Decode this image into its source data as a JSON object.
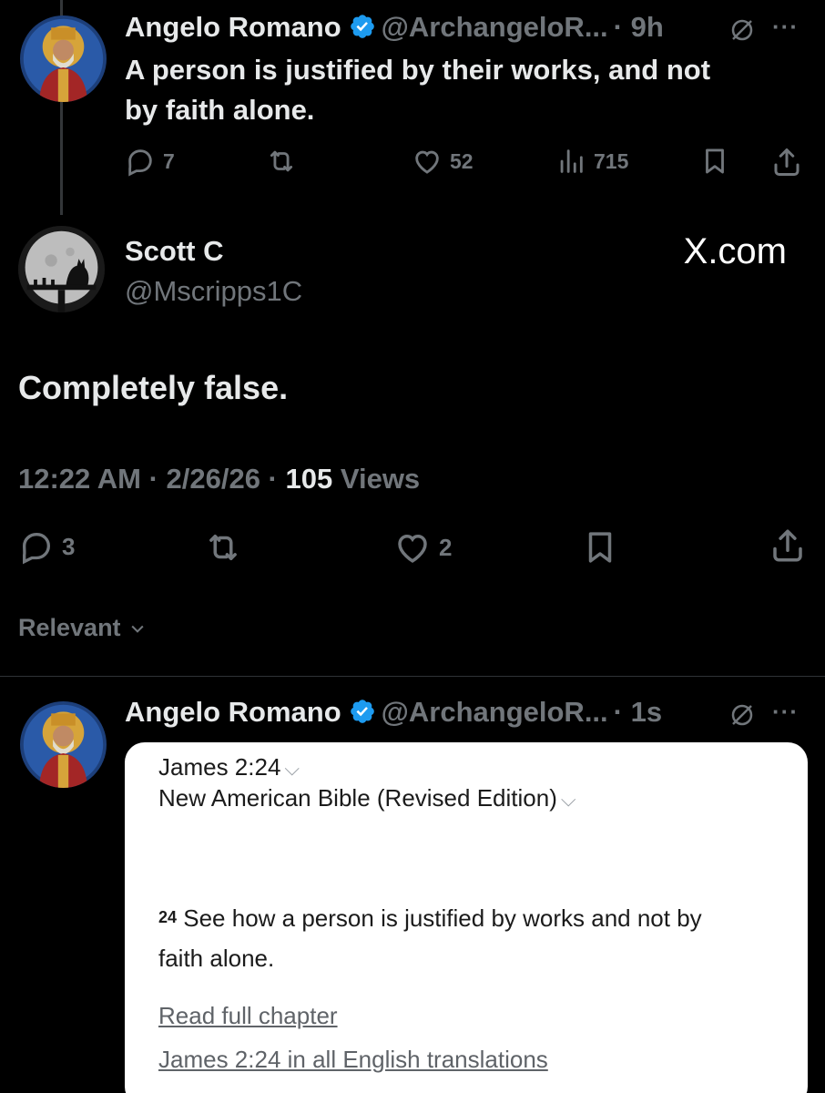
{
  "tweet1": {
    "name": "Angelo Romano",
    "handle": "@ArchangeloR...",
    "time": "· 9h",
    "text_line1": "A person is justified by their works, and not",
    "text_line2": "by faith alone.",
    "replies": "7",
    "likes": "52",
    "views": "715"
  },
  "main": {
    "name": "Scott C",
    "handle": "@Mscripps1C",
    "watermark": "X.com",
    "text": "Completely false.",
    "timestamp": "12:22 AM · 2/26/26 · ",
    "views_count": "105",
    "views_label": " Views",
    "replies": "3",
    "likes": "2",
    "sort_label": "Relevant"
  },
  "reply": {
    "name": "Angelo Romano",
    "handle": "@ArchangeloR...",
    "time": "· 1s",
    "card": {
      "reference": "James 2:24",
      "version": "New American Bible (Revised Edition)",
      "verse_number": "24",
      "verse_line1": " See how a person is justified by works and not by",
      "verse_line2": "faith alone.",
      "link1": "Read full chapter",
      "link2": "James 2:24 in all English translations"
    }
  },
  "colors": {
    "background": "#000000",
    "text": "#e7e9ea",
    "muted": "#71767b",
    "verified": "#1d9bf0"
  }
}
